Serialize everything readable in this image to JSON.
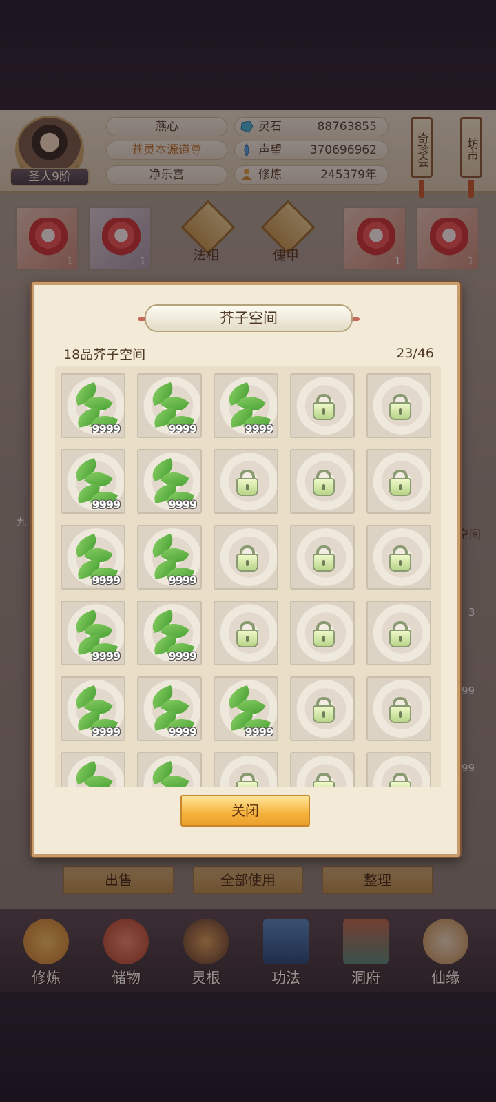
{
  "player": {
    "rank": "圣人9阶",
    "name": "燕心",
    "title": "苍灵本源道尊",
    "sect": "净乐宫"
  },
  "stats": [
    {
      "icon": "spirit-stone-icon",
      "label": "灵石",
      "value": "88763855"
    },
    {
      "icon": "reputation-icon",
      "label": "声望",
      "value": "370696962"
    },
    {
      "icon": "cultivation-icon",
      "label": "修炼",
      "value": "245379年"
    }
  ],
  "banners": {
    "treasure": "奇珍会",
    "market": "坊市"
  },
  "background": {
    "slot_count": "1",
    "tab_dharma": "法相",
    "tab_puppet": "傀甲",
    "tab_space": "空间",
    "count_3": "3",
    "count_99": "99",
    "partial_label": "九"
  },
  "bottom_buttons": {
    "sell": "出售",
    "use_all": "全部使用",
    "sort": "整理"
  },
  "nav": [
    {
      "label": "修炼",
      "icon": "cultivate-icon"
    },
    {
      "label": "储物",
      "icon": "storage-bag-icon"
    },
    {
      "label": "灵根",
      "icon": "spirit-root-icon"
    },
    {
      "label": "功法",
      "icon": "technique-book-icon"
    },
    {
      "label": "洞府",
      "icon": "cave-dwelling-icon"
    },
    {
      "label": "仙缘",
      "icon": "immortal-fate-icon"
    }
  ],
  "modal": {
    "title": "芥子空间",
    "subtitle": "18品芥子空间",
    "capacity": "23/46",
    "close_label": "关闭",
    "item_qty": "9999",
    "rows": [
      [
        "herb",
        "herb",
        "herb",
        "locked",
        "locked"
      ],
      [
        "herb",
        "herb",
        "locked",
        "locked",
        "locked"
      ],
      [
        "herb",
        "herb",
        "locked",
        "locked",
        "locked"
      ],
      [
        "herb",
        "herb",
        "locked",
        "locked",
        "locked"
      ],
      [
        "herb",
        "herb",
        "herb",
        "locked",
        "locked"
      ],
      [
        "herb",
        "herb",
        "locked",
        "locked",
        "locked"
      ]
    ]
  },
  "colors": {
    "accent_gold": "#f5b23b",
    "panel": "#f3ead7",
    "herb_green": "#3f9a2c",
    "lock": "#b8d68a"
  }
}
